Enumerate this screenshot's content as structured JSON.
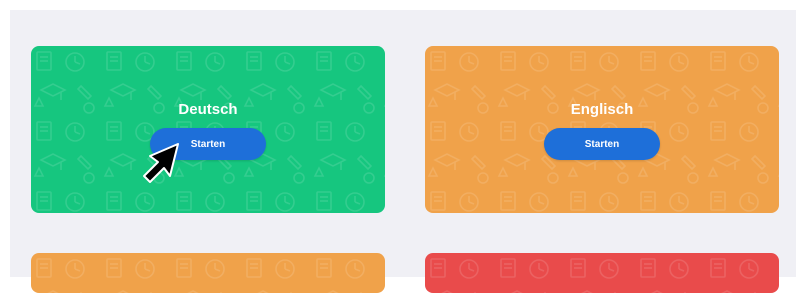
{
  "cards": [
    {
      "title": "Deutsch",
      "button_label": "Starten",
      "color": "#16c67f"
    },
    {
      "title": "Englisch",
      "button_label": "Starten",
      "color": "#f0a24a"
    },
    {
      "title": "",
      "button_label": "",
      "color": "#f0a24a"
    },
    {
      "title": "",
      "button_label": "",
      "color": "#e94b4b"
    }
  ],
  "theme": {
    "button_color": "#1e6fd9",
    "page_background": "#f0f0f5"
  },
  "icons": [
    "pattern-school-supplies-icon",
    "mouse-pointer-icon"
  ]
}
